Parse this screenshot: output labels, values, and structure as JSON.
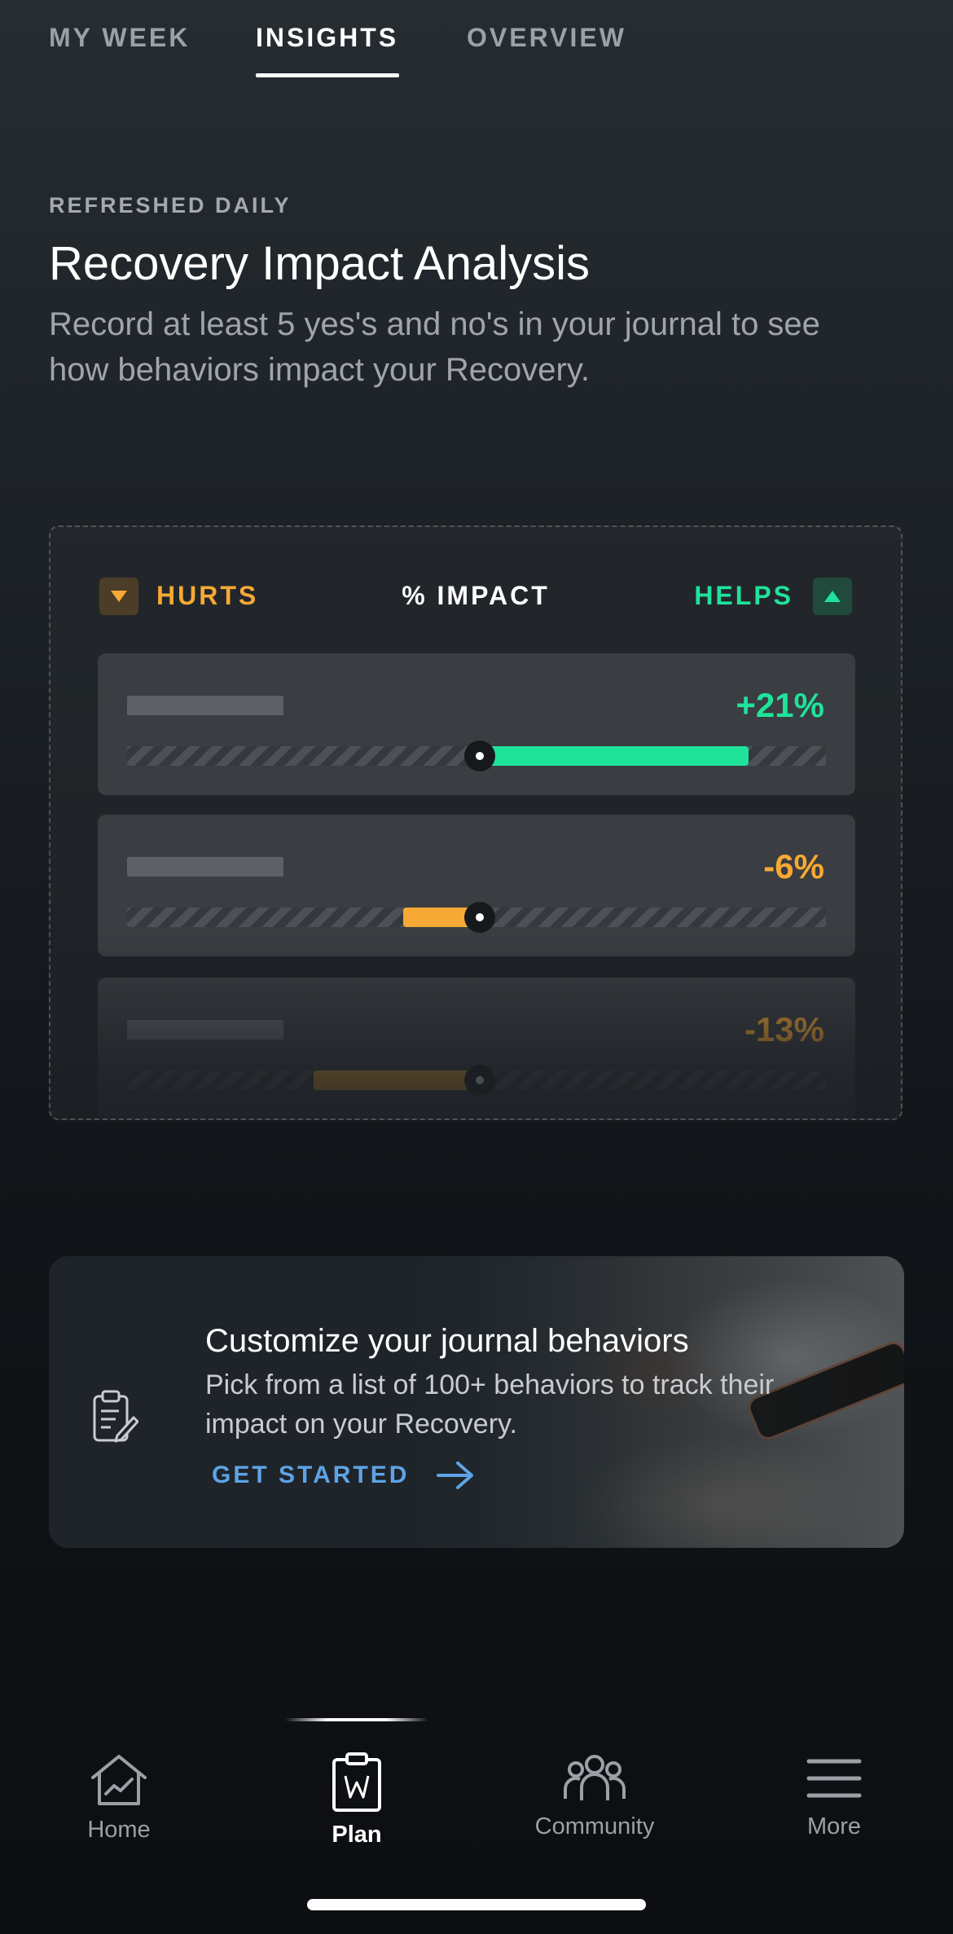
{
  "tabs": [
    {
      "label": "MY WEEK",
      "active": false
    },
    {
      "label": "INSIGHTS",
      "active": true
    },
    {
      "label": "OVERVIEW",
      "active": false
    }
  ],
  "header": {
    "eyebrow": "REFRESHED DAILY",
    "title": "Recovery Impact Analysis",
    "subtitle": "Record at least 5 yes's and no's in your journal to see how behaviors impact your Recovery."
  },
  "impact": {
    "hurts_label": "HURTS",
    "impact_label": "% IMPACT",
    "helps_label": "HELPS",
    "rows": [
      {
        "value": "+21%",
        "impact_pct": 21,
        "color": "#1fe39b"
      },
      {
        "value": "-6%",
        "impact_pct": -6,
        "color": "#f6a934"
      },
      {
        "value": "-13%",
        "impact_pct": -13,
        "color": "#f6a934"
      }
    ]
  },
  "promo": {
    "title": "Customize your journal behaviors",
    "text": "Pick from a list of 100+ behaviors to track their impact on your Recovery.",
    "cta": "GET STARTED"
  },
  "nav": {
    "items": [
      {
        "label": "Home",
        "icon": "home-chart-icon",
        "active": false
      },
      {
        "label": "Plan",
        "icon": "clipboard-icon",
        "active": true
      },
      {
        "label": "Community",
        "icon": "people-icon",
        "active": false
      },
      {
        "label": "More",
        "icon": "menu-icon",
        "active": false
      }
    ]
  },
  "colors": {
    "helps": "#1fe39b",
    "hurts": "#f6a934",
    "link": "#5ea3e6"
  }
}
